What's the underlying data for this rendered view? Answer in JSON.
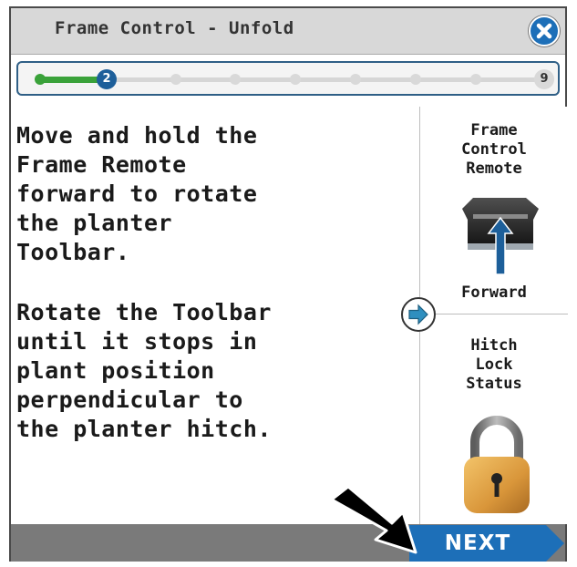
{
  "window": {
    "title": "Frame Control - Unfold"
  },
  "progress": {
    "current_step": "2",
    "total_steps": "9",
    "fraction_complete": 0.11
  },
  "instructions": {
    "paragraph_1": "Move and hold the\nFrame Remote\nforward to rotate\nthe planter\nToolbar.",
    "paragraph_2": "Rotate the Toolbar\nuntil it stops in\nplant position\nperpendicular to\nthe planter hitch."
  },
  "side_panel": {
    "remote_title": "Frame\nControl\nRemote",
    "remote_direction": "Forward",
    "hitch_title": "Hitch\nLock\nStatus"
  },
  "footer": {
    "next_label": "NEXT"
  },
  "colors": {
    "accent_blue": "#1d6fb8",
    "progress_green": "#3aa23a",
    "lock_gold": "#e0a642"
  }
}
